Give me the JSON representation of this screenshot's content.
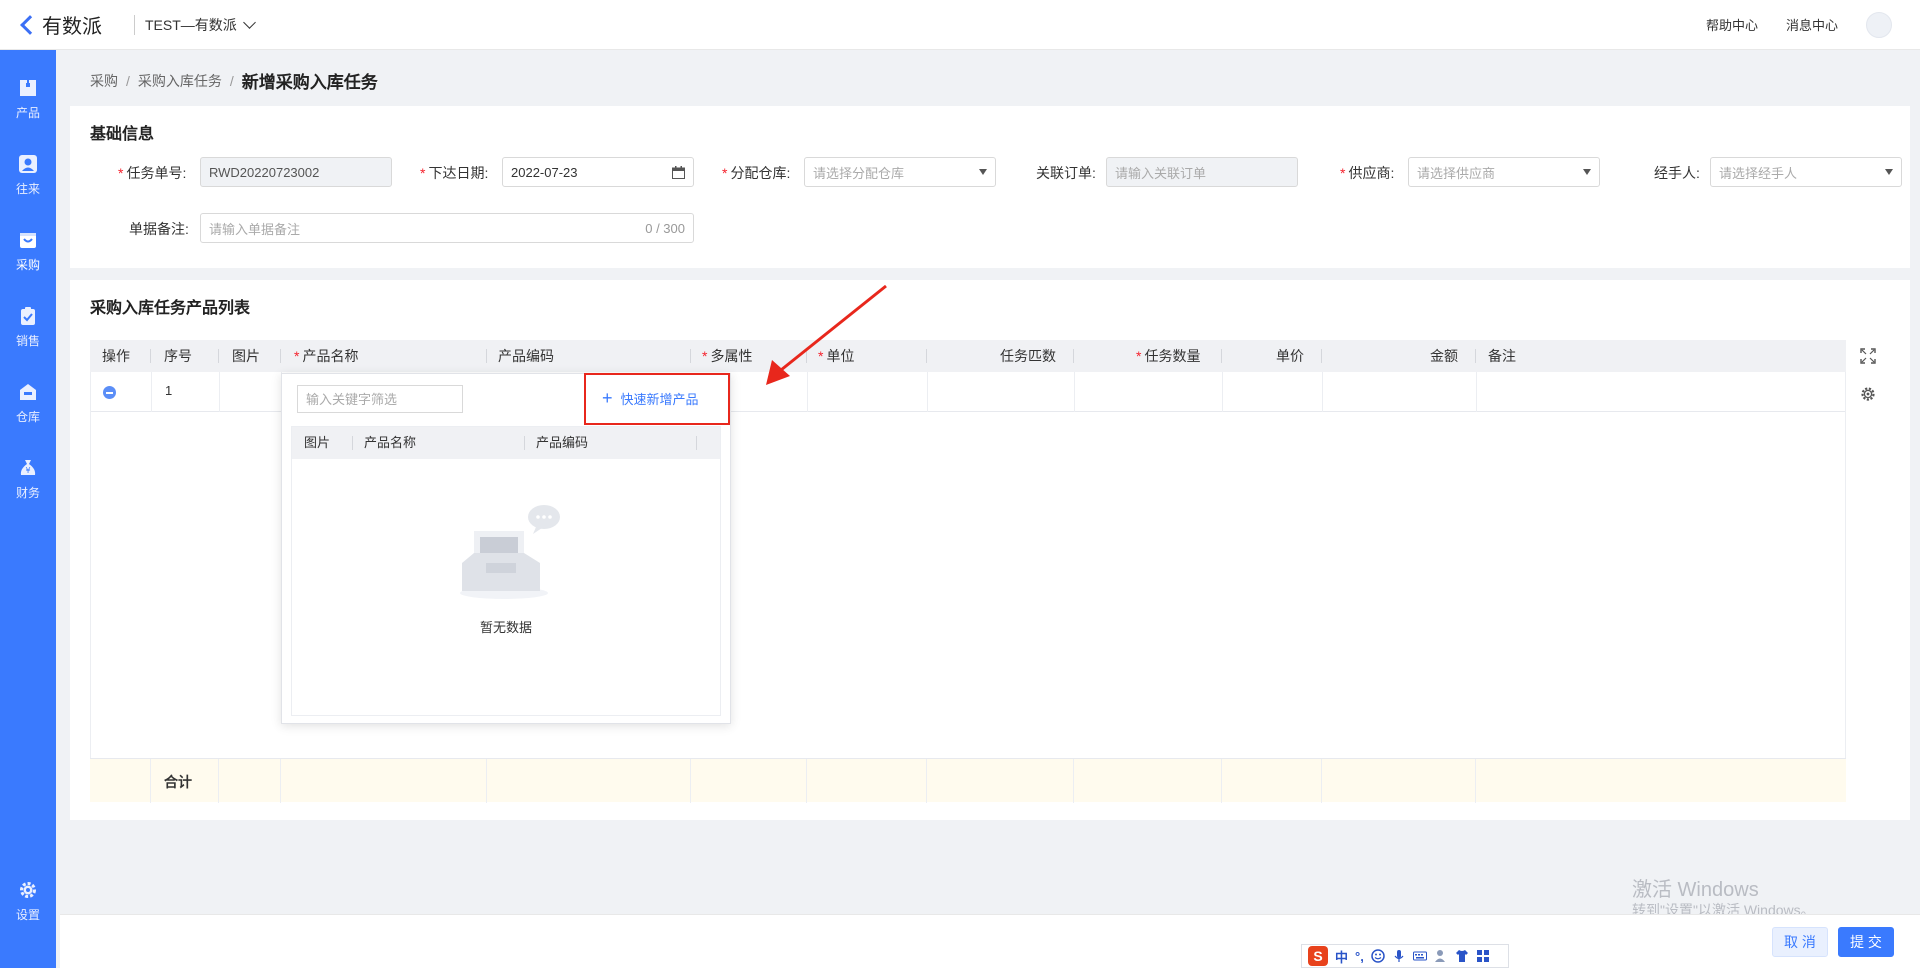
{
  "app": {
    "logo_text": "有数派",
    "tenant": "TEST—有数派"
  },
  "header": {
    "help": "帮助中心",
    "messages": "消息中心"
  },
  "sidebar": {
    "items": [
      {
        "label": "产品",
        "icon": "box-icon"
      },
      {
        "label": "往来",
        "icon": "contact-icon"
      },
      {
        "label": "采购",
        "icon": "cart-icon",
        "active": true
      },
      {
        "label": "销售",
        "icon": "clipboard-icon"
      },
      {
        "label": "仓库",
        "icon": "warehouse-icon"
      },
      {
        "label": "财务",
        "icon": "money-bag-icon"
      }
    ],
    "settings": "设置"
  },
  "breadcrumb": {
    "level1": "采购",
    "level2": "采购入库任务",
    "current": "新增采购入库任务"
  },
  "basic": {
    "title": "基础信息",
    "task_no_label": "任务单号:",
    "task_no_value": "RWD20220723002",
    "date_label": "下达日期:",
    "date_value": "2022-07-23",
    "warehouse_label": "分配仓库:",
    "warehouse_placeholder": "请选择分配仓库",
    "order_label": "关联订单:",
    "order_placeholder": "请输入关联订单",
    "supplier_label": "供应商:",
    "supplier_placeholder": "请选择供应商",
    "handler_label": "经手人:",
    "handler_placeholder": "请选择经手人",
    "remark_label": "单据备注:",
    "remark_placeholder": "请输入单据备注",
    "remark_count": "0 / 300"
  },
  "product_list": {
    "title": "采购入库任务产品列表",
    "columns": {
      "op": "操作",
      "seq": "序号",
      "image": "图片",
      "name": "产品名称",
      "code": "产品编码",
      "attr": "多属性",
      "unit": "单位",
      "match": "任务匹数",
      "qty": "任务数量",
      "price": "单价",
      "amount": "金额",
      "remark": "备注"
    },
    "row1_seq": "1",
    "total_label": "合计"
  },
  "popup": {
    "search_placeholder": "输入关键字筛选",
    "quick_add": "快速新增产品",
    "col_image": "图片",
    "col_name": "产品名称",
    "col_code": "产品编码",
    "empty": "暂无数据"
  },
  "footer": {
    "cancel": "取 消",
    "submit": "提 交"
  },
  "watermark": {
    "line1": "激活 Windows",
    "line2": "转到\"设置\"以激活 Windows。"
  },
  "ime": {
    "lang": "中"
  },
  "colors": {
    "primary": "#3a7afe",
    "sidebar": "#3a7afe",
    "required": "#f5222d",
    "annotation": "#e8271c",
    "total_row": "#fffbee"
  }
}
